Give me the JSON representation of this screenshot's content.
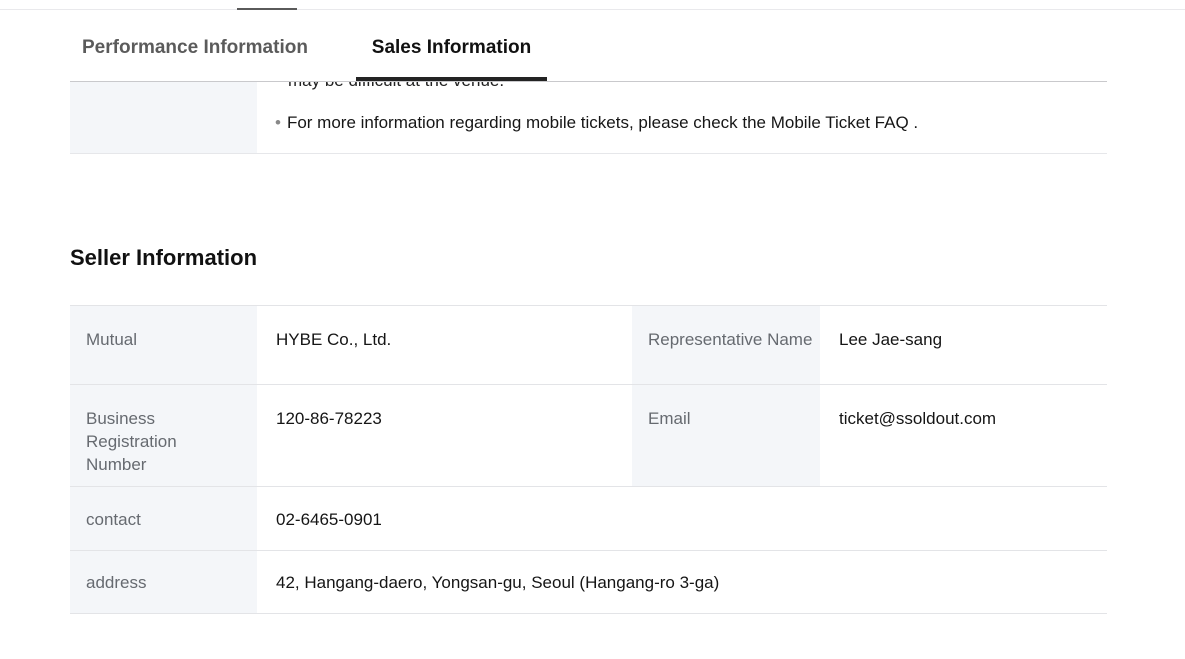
{
  "tabs": {
    "performance": "Performance Information",
    "sales": "Sales Information"
  },
  "notice": {
    "clipped_text": "may be difficult at the venue.",
    "mobile_ticket_info": "For more information regarding mobile tickets, please check the Mobile Ticket FAQ ."
  },
  "seller": {
    "title": "Seller Information",
    "mutual_label": "Mutual",
    "mutual_value": "HYBE Co., Ltd.",
    "representative_label": "Representative Name",
    "representative_value": "Lee Jae-sang",
    "business_label": "Business Registration Number",
    "business_value": "120-86-78223",
    "email_label": "Email",
    "email_value": "ticket@ssoldout.com",
    "contact_label": "contact",
    "contact_value": "02-6465-0901",
    "address_label": "address",
    "address_value": "42, Hangang-daero, Yongsan-gu, Seoul (Hangang-ro 3-ga)"
  },
  "colors": {
    "header_bg": "#f4f6f9",
    "border": "#e3e4e7",
    "active_tab": "#232323"
  }
}
